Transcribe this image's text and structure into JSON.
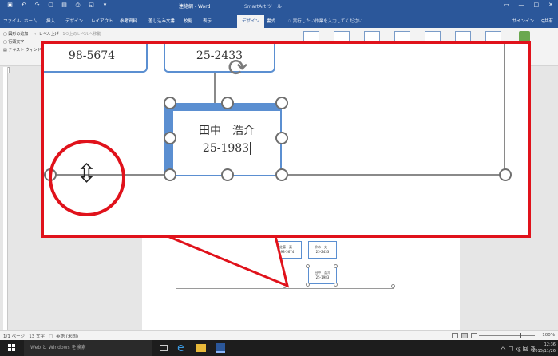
{
  "window": {
    "doc_title": "連絡網 - Word",
    "context_title": "SmartArt ツール",
    "controls": [
      "—",
      "□",
      "✕"
    ]
  },
  "tabs": {
    "items": [
      "ファイル",
      "ホーム",
      "挿入",
      "デザイン",
      "レイアウト",
      "参考資料",
      "差し込み文書",
      "校閲",
      "表示",
      "デザイン",
      "書式"
    ],
    "active_index": 9,
    "tell_me": "実行したい作業を入力してください...",
    "sign_in": "サインイン",
    "share": "共有"
  },
  "ribbon": {
    "add_shape": "図形の追加",
    "level_up": "レベル上げ",
    "level_up_hint": "1つ上のレベルへ移動",
    "add_bullet": "行頭文字",
    "text_pane": "テキスト ウィンドウ"
  },
  "zoom": {
    "top_left_text": "98-5674",
    "top_mid_text": "25-2433",
    "selected_name": "田中　浩介",
    "selected_number": "25-1983"
  },
  "page_smartart": {
    "box1_name": "佐藤　真一",
    "box1_num": "98-5674",
    "box2_name": "鈴木　太一",
    "box2_num": "25-2433",
    "box3_name": "田中　浩介",
    "box3_num": "25-1983"
  },
  "status": {
    "pages": "1/1 ページ",
    "words": "13 文字",
    "lang": "英語 (米国)",
    "zoom": "100%"
  },
  "taskbar": {
    "search": "Web と Windows を検索",
    "tray": "へ 口 ㎏ 回 あ",
    "time": "12:36",
    "date": "2015/11/26"
  },
  "colors": {
    "word_blue": "#2b579a",
    "smartart_blue": "#5b8fd1",
    "highlight_red": "#e0121b"
  }
}
